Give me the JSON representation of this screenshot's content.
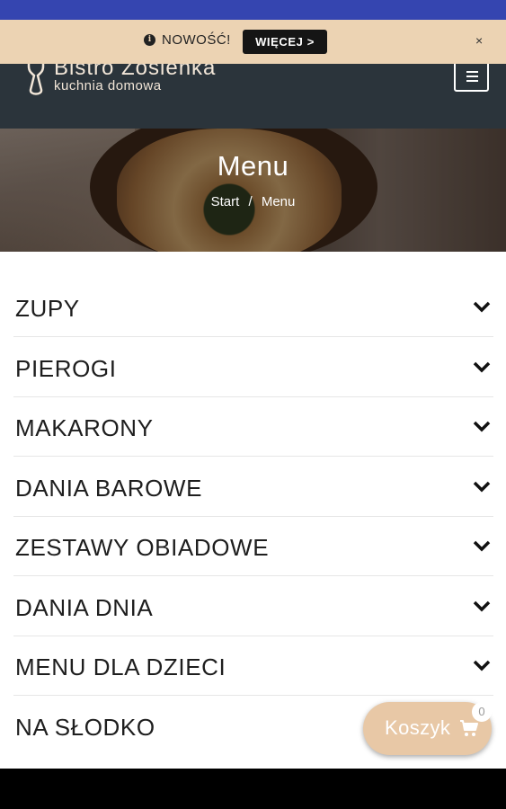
{
  "header": {
    "logo_name": "Bistro Zosieńka",
    "logo_tagline": "kuchnia domowa",
    "menu_icon": "hamburger-icon"
  },
  "notice": {
    "icon": "info-icon",
    "info_glyph": "i",
    "text": "NOWOŚĆ!",
    "button_label": "WIĘCEJ >",
    "close_label": "×"
  },
  "hero": {
    "title": "Menu",
    "breadcrumb": {
      "home": "Start",
      "separator": "/",
      "current": "Menu"
    }
  },
  "menu": {
    "items": [
      {
        "label": "ZUPY",
        "icon": "chevron-down-icon"
      },
      {
        "label": "PIEROGI",
        "icon": "chevron-down-icon"
      },
      {
        "label": "MAKARONY",
        "icon": "chevron-down-icon"
      },
      {
        "label": "DANIA BAROWE",
        "icon": "chevron-down-icon"
      },
      {
        "label": "ZESTAWY OBIADOWE",
        "icon": "chevron-down-icon"
      },
      {
        "label": "DANIA DNIA",
        "icon": "chevron-down-icon"
      },
      {
        "label": "MENU DLA DZIECI",
        "icon": "chevron-down-icon"
      },
      {
        "label": "NA SŁODKO",
        "icon": "chevron-down-icon"
      }
    ]
  },
  "cart": {
    "label": "Koszyk",
    "count": "0",
    "icon": "shopping-cart-icon"
  },
  "colors": {
    "status_bar": "#3545b0",
    "header_bg": "#2b343b",
    "notice_bg": "#ecd3b3",
    "accent": "#e8c8a6"
  }
}
